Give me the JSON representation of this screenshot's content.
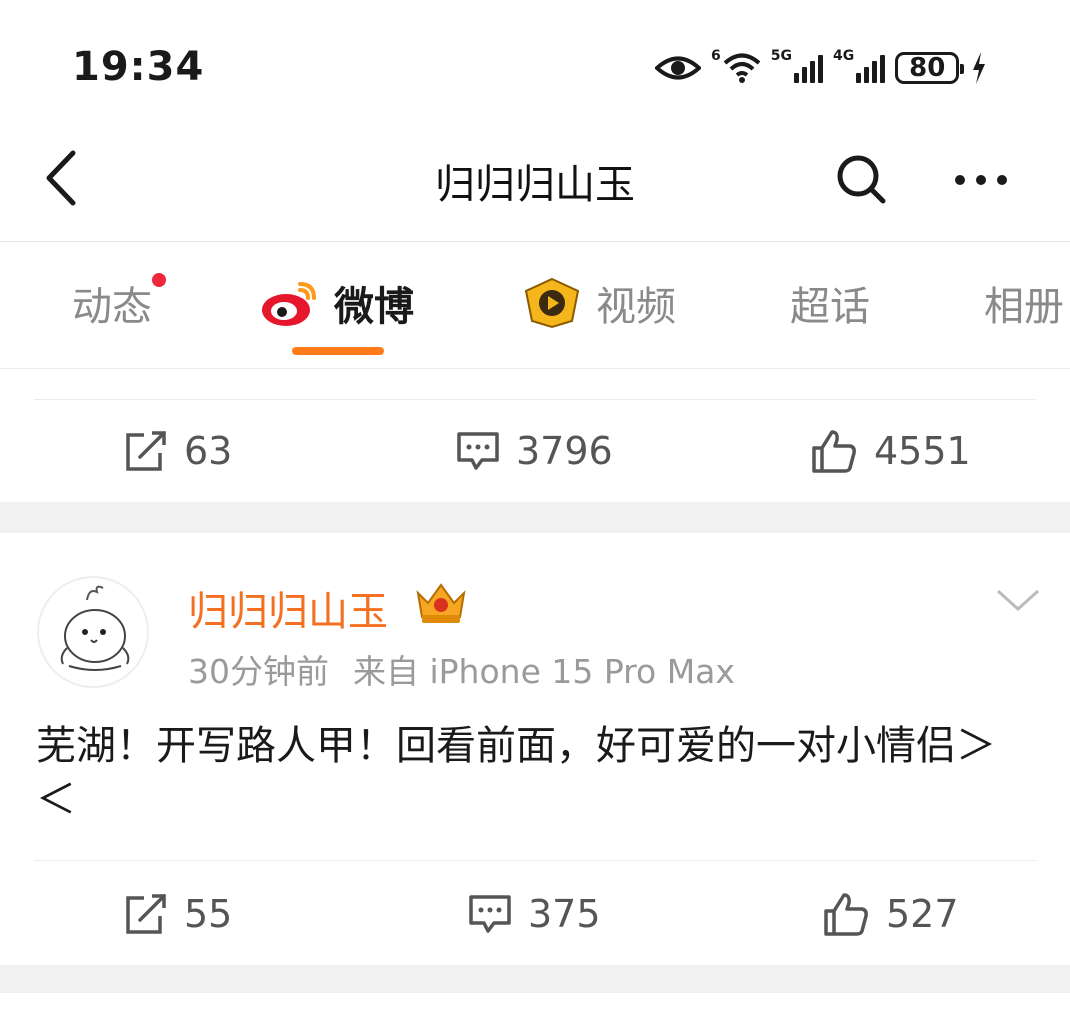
{
  "status_bar": {
    "time": "19:34",
    "wifi_badge": "6",
    "sim1_label": "5G",
    "sim2_label": "4G",
    "battery": "80"
  },
  "header": {
    "title": "归归归山玉",
    "back_icon": "chevron-left-icon",
    "search_icon": "search-icon",
    "more_icon": "more-dots-icon"
  },
  "tabs": [
    {
      "label": "动态",
      "has_dot": true
    },
    {
      "label": "微博",
      "active": true
    },
    {
      "label": "视频"
    },
    {
      "label": "超话"
    },
    {
      "label": "相册"
    }
  ],
  "colors": {
    "accent": "#ff7a1a",
    "username": "#f36f21",
    "notify_dot": "#f0263b",
    "band": "#f1f1f1"
  },
  "prev_post_actions": {
    "repost": "63",
    "comment": "3796",
    "like": "4551"
  },
  "post": {
    "user": "归归归山玉",
    "time": "30分钟前",
    "source": "来自 iPhone 15 Pro Max",
    "text": "芜湖！开写路人甲！回看前面，好可爱的一对小情侣＞ ＜",
    "actions": {
      "repost": "55",
      "comment": "375",
      "like": "527"
    }
  }
}
